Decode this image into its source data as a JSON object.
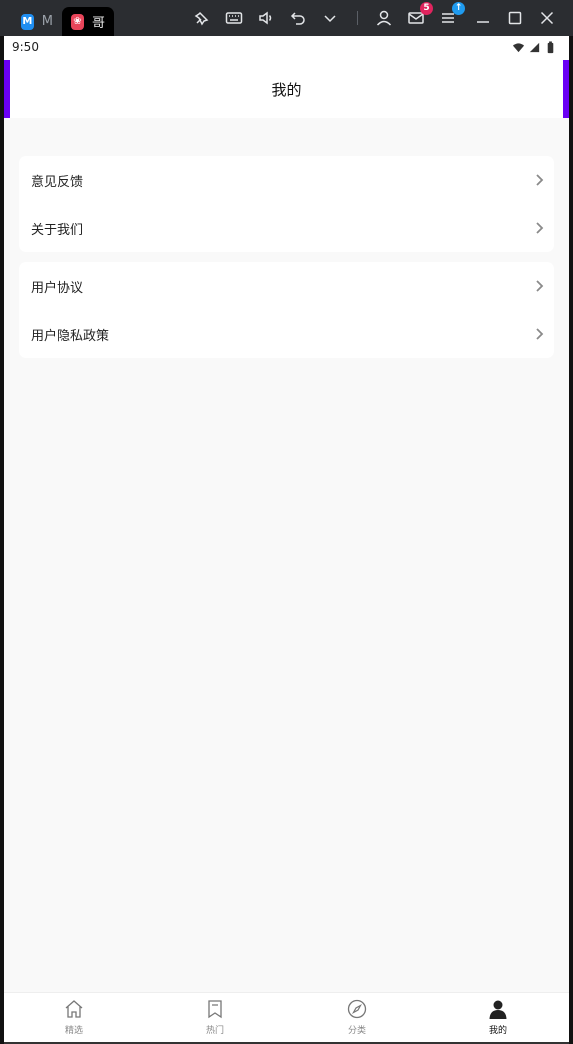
{
  "titlebar": {
    "tabs": [
      {
        "label": "M",
        "logo": "M"
      },
      {
        "label": "哥",
        "logo": "❀"
      }
    ],
    "mail_badge": "5",
    "update_badge": "↑"
  },
  "statusbar": {
    "time": "9:50"
  },
  "navbar": {
    "title": "我的",
    "accent_color": "#6a00f4"
  },
  "menu": {
    "group1": [
      {
        "label": "意见反馈"
      },
      {
        "label": "关于我们"
      }
    ],
    "group2": [
      {
        "label": "用户协议"
      },
      {
        "label": "用户隐私政策"
      }
    ]
  },
  "tabbar": {
    "items": [
      {
        "label": "精选",
        "icon": "home-icon"
      },
      {
        "label": "热门",
        "icon": "bookmark-icon"
      },
      {
        "label": "分类",
        "icon": "compass-icon"
      },
      {
        "label": "我的",
        "icon": "person-icon",
        "active": true
      }
    ]
  }
}
